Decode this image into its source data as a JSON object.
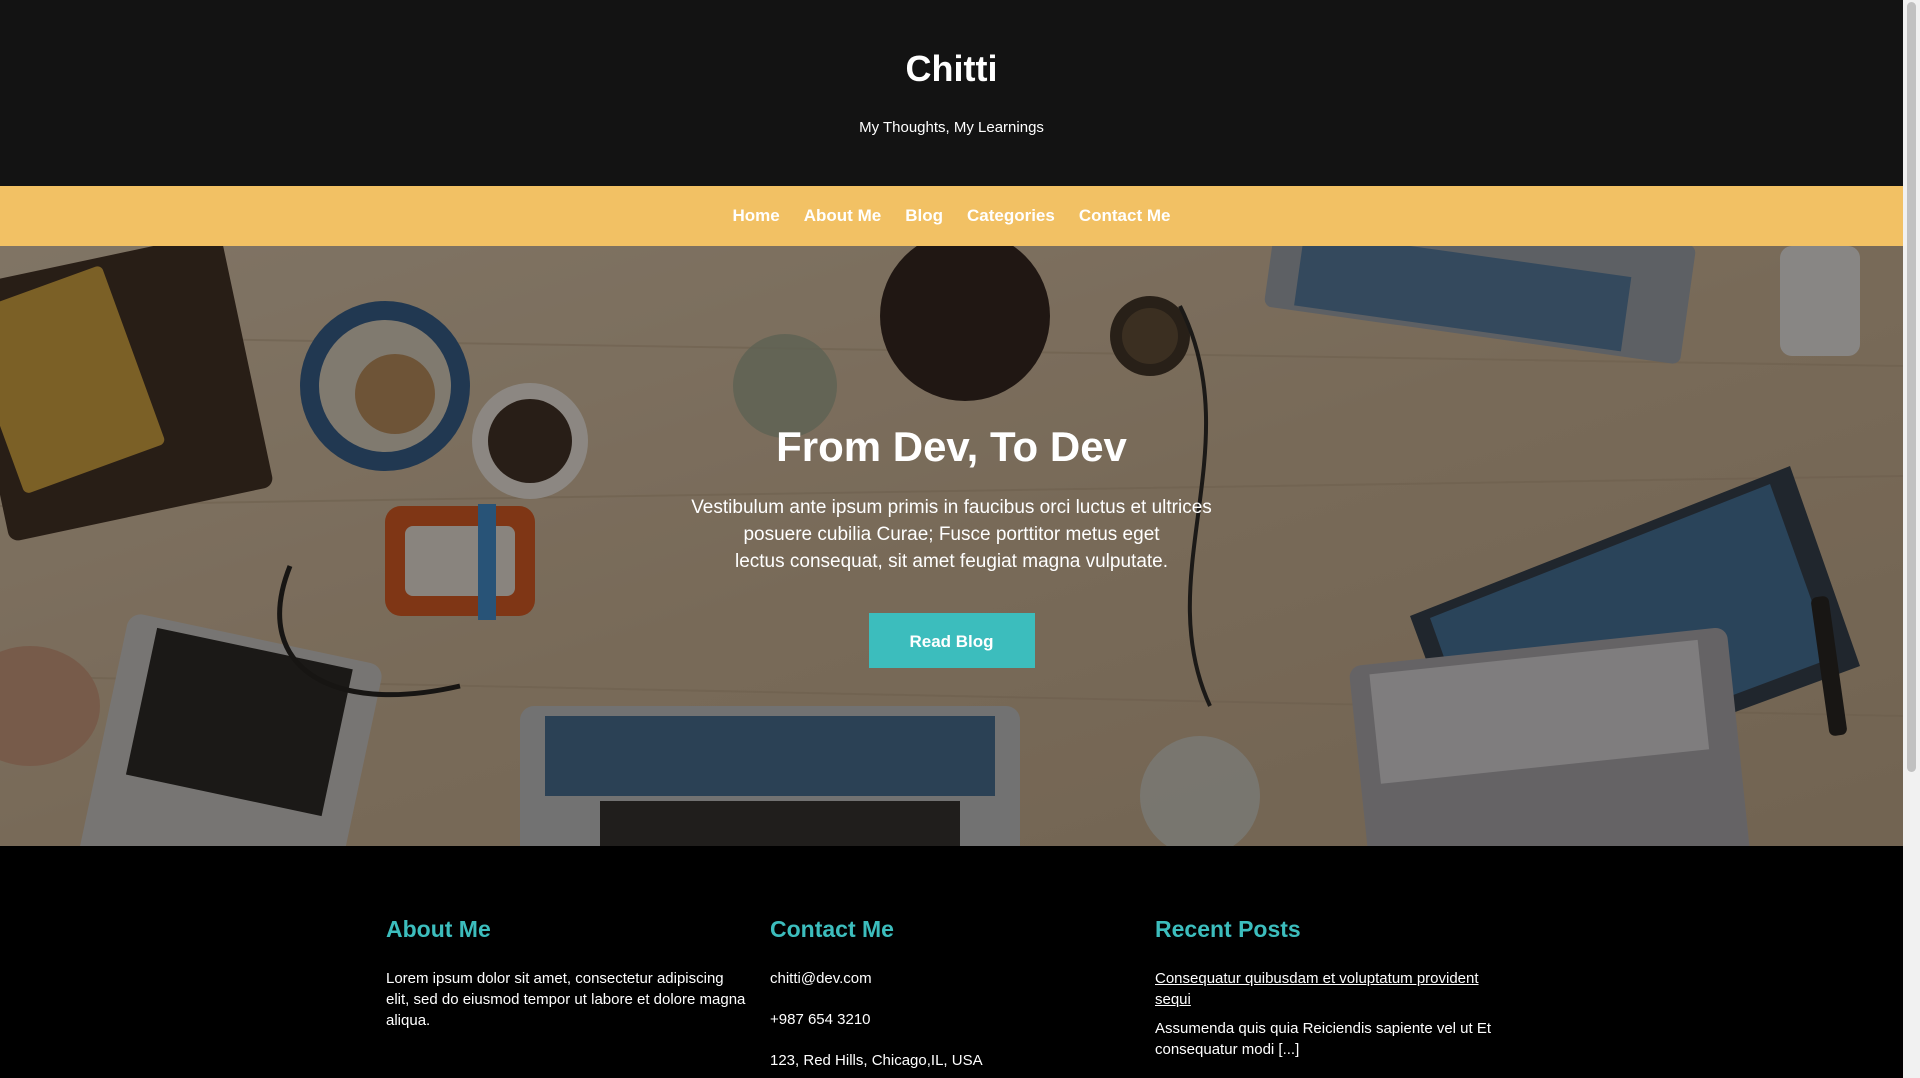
{
  "header": {
    "title": "Chitti",
    "tagline": "My Thoughts, My Learnings"
  },
  "nav": {
    "items": [
      "Home",
      "About Me",
      "Blog",
      "Categories",
      "Contact Me"
    ]
  },
  "hero": {
    "heading": "From Dev, To Dev",
    "text_lines": [
      "Vestibulum ante ipsum primis in faucibus orci luctus et ultrices",
      "posuere cubilia Curae; Fusce porttitor metus eget",
      "lectus consequat, sit amet feugiat magna vulputate."
    ],
    "button": "Read Blog"
  },
  "footer": {
    "about": {
      "heading": "About Me",
      "text": "Lorem ipsum dolor sit amet, consectetur adipiscing elit, sed do eiusmod tempor ut labore et dolore magna aliqua."
    },
    "contact": {
      "heading": "Contact Me",
      "email": "chitti@dev.com",
      "phone": "+987 654 3210",
      "address": "123, Red Hills, Chicago,IL, USA"
    },
    "recent_posts": {
      "heading": "Recent Posts",
      "posts": [
        {
          "title": "Consequatur quibusdam et voluptatum provident sequi",
          "excerpt": "Assumenda quis quia Reiciendis sapiente vel ut Et consequatur modi [...]"
        }
      ]
    }
  },
  "colors": {
    "header_bg": "#131313",
    "nav_bg": "#f2c164",
    "accent": "#3cbdbd",
    "footer_bg": "#000000"
  }
}
